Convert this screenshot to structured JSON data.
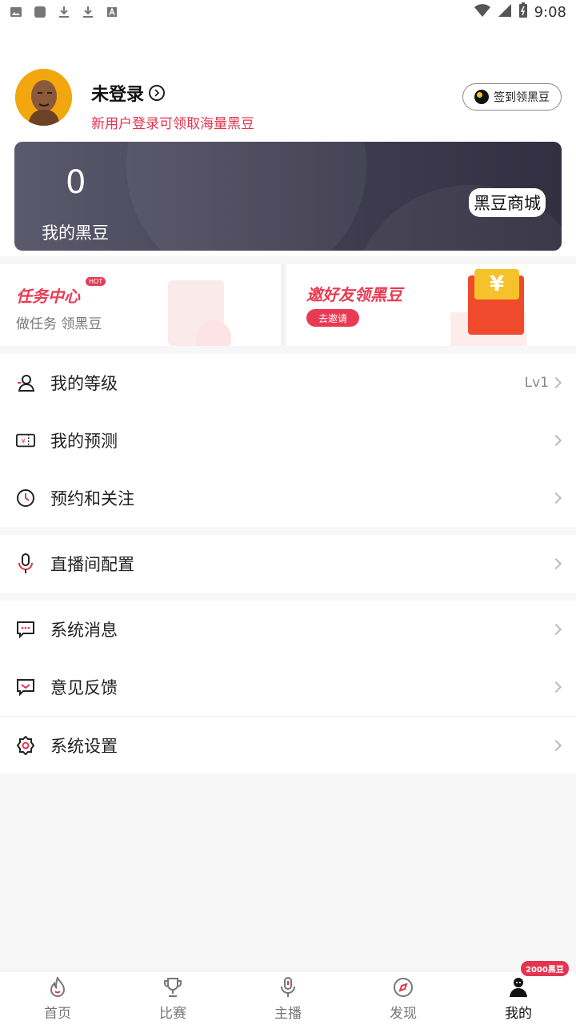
{
  "status_bar": {
    "time": "9:08"
  },
  "profile": {
    "name": "未登录",
    "subtitle": "新用户登录可领取海量黑豆",
    "signin_label": "签到领黑豆"
  },
  "beans": {
    "count": "0",
    "label": "我的黑豆",
    "mall_label": "黑豆商城"
  },
  "promo": {
    "task_title": "任务中心",
    "task_badge": "HOT",
    "task_sub": "做任务 领黑豆",
    "invite_title": "邀好友领黑豆",
    "invite_button": "去邀请",
    "coin_symbol": "¥"
  },
  "menu_group_1": [
    {
      "label": "我的等级",
      "value": "Lv1"
    },
    {
      "label": "我的预测"
    },
    {
      "label": "预约和关注"
    }
  ],
  "menu_group_2": [
    {
      "label": "直播间配置"
    }
  ],
  "menu_group_3": [
    {
      "label": "系统消息"
    },
    {
      "label": "意见反馈"
    },
    {
      "label": "系统设置"
    }
  ],
  "tabbar": {
    "tabs": [
      {
        "label": "首页",
        "icon": "flame-icon"
      },
      {
        "label": "比赛",
        "icon": "trophy-icon"
      },
      {
        "label": "主播",
        "icon": "microphone-icon"
      },
      {
        "label": "发现",
        "icon": "compass-icon"
      },
      {
        "label": "我的",
        "icon": "person-icon",
        "active": true
      }
    ],
    "badge": "2000黑豆"
  },
  "colors": {
    "accent": "#e5344f",
    "card_dark": "#3e3c4e"
  }
}
